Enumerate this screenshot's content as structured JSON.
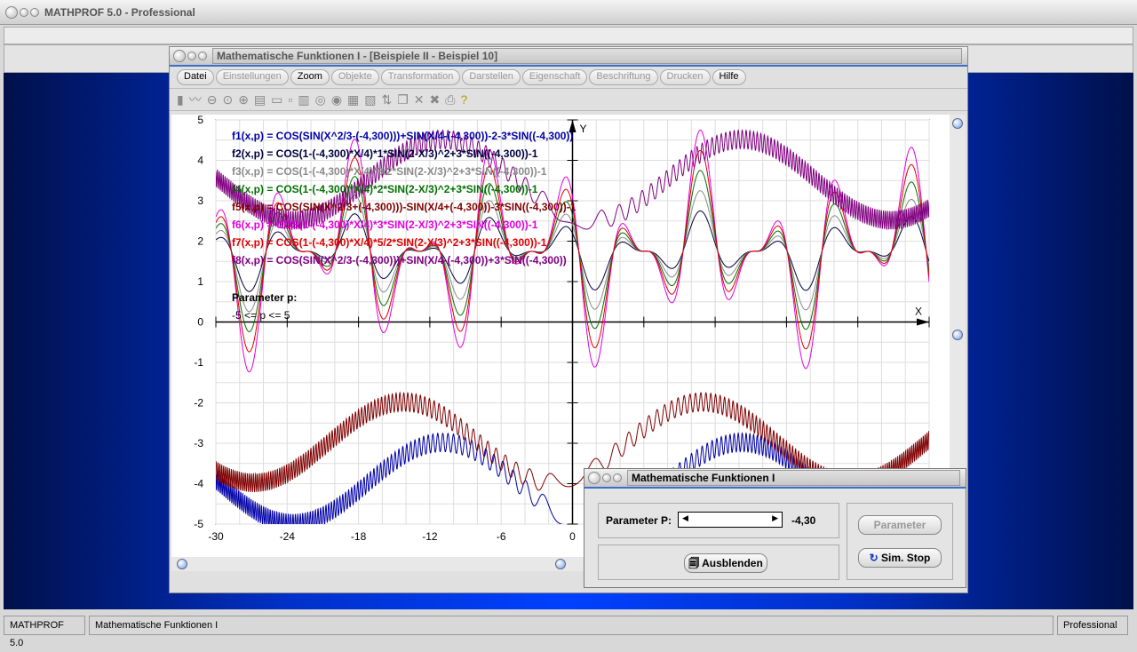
{
  "app": {
    "title": "MATHPROF 5.0 - Professional"
  },
  "window": {
    "title": "Mathematische Funktionen I - [Beispiele II - Beispiel 10]",
    "menu": [
      {
        "label": "Datei",
        "enabled": true
      },
      {
        "label": "Einstellungen",
        "enabled": false
      },
      {
        "label": "Zoom",
        "enabled": true
      },
      {
        "label": "Objekte",
        "enabled": false
      },
      {
        "label": "Transformation",
        "enabled": false
      },
      {
        "label": "Darstellen",
        "enabled": false
      },
      {
        "label": "Eigenschaft",
        "enabled": false
      },
      {
        "label": "Beschriftung",
        "enabled": false
      },
      {
        "label": "Drucken",
        "enabled": false
      },
      {
        "label": "Hilfe",
        "enabled": true
      }
    ],
    "toolbar": [
      "select-tool",
      "trace-tool",
      "zoom-out",
      "zoom-reset",
      "zoom-in",
      "properties",
      "window-tool",
      "box-tool",
      "columns-tool",
      "circle-tool",
      "circle-tool-2",
      "table-tool",
      "chart-tool",
      "swap-tool",
      "copy-tool",
      "cross-tool",
      "cross-tool-2",
      "print-tool",
      "help-tool"
    ]
  },
  "chart_data": {
    "type": "line",
    "xlim": [
      -30,
      30
    ],
    "ylim": [
      -5,
      5
    ],
    "grid": true,
    "xticks": [
      "-30",
      "-24",
      "-18",
      "-12",
      "-6",
      "0"
    ],
    "yticks": [
      "5",
      "4",
      "3",
      "2",
      "1",
      "0",
      "-1",
      "-2",
      "-3",
      "-4",
      "-5"
    ],
    "xlabel": "X",
    "ylabel": "Y",
    "p": -4.3,
    "series": [
      {
        "name": "f1(x,p) = COS(SIN(X^2/3-(-4,300)))+SIN(X/4-(-4,300))-2-3*SIN((-4,300))",
        "color": "#0000a8"
      },
      {
        "name": "f2(x,p) = COS(1-(-4,300)*X/4)*1*SIN(2-X/3)^2+3*SIN((-4,300))-1",
        "color": "#000040"
      },
      {
        "name": "f3(x,p) = COS(1-(-4,300)*X/4)*3/2*SIN(2-X/3)^2+3*SIN((-4,300))-1",
        "color": "#8a8a8a"
      },
      {
        "name": "f4(x,p) = COS(1-(-4,300)*X/4)*2*SIN(2-X/3)^2+3*SIN((-4,300))-1",
        "color": "#007000"
      },
      {
        "name": "f5(x,p) = COS(SIN(X^2/3+(-4,300)))-SIN(X/4+(-4,300))-3*SIN((-4,300))-1",
        "color": "#800000"
      },
      {
        "name": "f6(x,p) = COS(1-(-4,300)*X/4)*3*SIN(2-X/3)^2+3*SIN((-4,300))-1",
        "color": "#e000e0"
      },
      {
        "name": "f7(x,p) = COS(1-(-4,300)*X/4)*5/2*SIN(2-X/3)^2+3*SIN((-4,300))-1",
        "color": "#e00000"
      },
      {
        "name": "f8(x,p) = COS(SIN(X^2/3-(-4,300)))+SIN(X/4-(-4,300))+3*SIN((-4,300))",
        "color": "#800080"
      }
    ],
    "annotation": [
      "Parameter p:",
      "-5 <= p <= 5"
    ]
  },
  "dialog": {
    "title": "Mathematische Funktionen I",
    "param_label": "Parameter P:",
    "param_value": "-4,30",
    "slider_fraction": 0.07,
    "hide_button": "Ausblenden",
    "param_button": "Parameter",
    "sim_button": "Sim. Stop"
  },
  "statusbar": [
    "MATHPROF 5.0",
    "Mathematische Funktionen I",
    "Professional"
  ]
}
